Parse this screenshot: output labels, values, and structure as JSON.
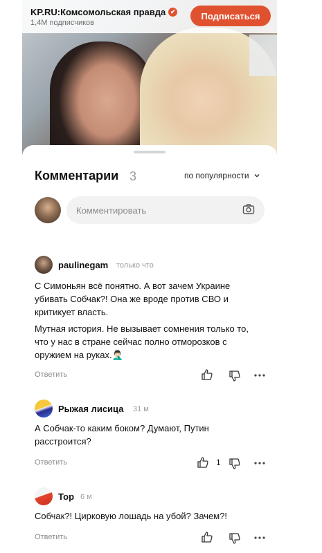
{
  "channel": {
    "name": "KP.RU:Комсомольская правда",
    "subscribers": "1,4М подписчиков",
    "subscribe_label": "Подписаться",
    "verified_icon": "✔"
  },
  "comments_panel": {
    "title": "Комментарии",
    "count": "3",
    "sort_label": "по популярности",
    "input_placeholder": "Комментировать"
  },
  "comments": [
    {
      "author": "paulinegam",
      "time": "только что",
      "paragraphs": [
        "С Симоньян всё понятно. А вот зачем Украине убивать Собчак?! Она же вроде против СВО и критикует власть.",
        "Мутная история. Не вызывает сомнения только то, что у нас в стране сейчас полно отморозков с оружием на руках.🤦🏻‍♂️"
      ],
      "reply_label": "Ответить",
      "likes": ""
    },
    {
      "author": "Рыжая лисица",
      "time": "31 м",
      "paragraphs": [
        "А Собчак-то каким боком? Думают, Путин расстроится?"
      ],
      "reply_label": "Ответить",
      "likes": "1"
    },
    {
      "author": "Тор",
      "time": "6 м",
      "paragraphs": [
        "Собчак?! Цирковую лошадь на убой? Зачем?!"
      ],
      "reply_label": "Ответить",
      "likes": ""
    }
  ],
  "colors": {
    "accent": "#e0522f"
  }
}
